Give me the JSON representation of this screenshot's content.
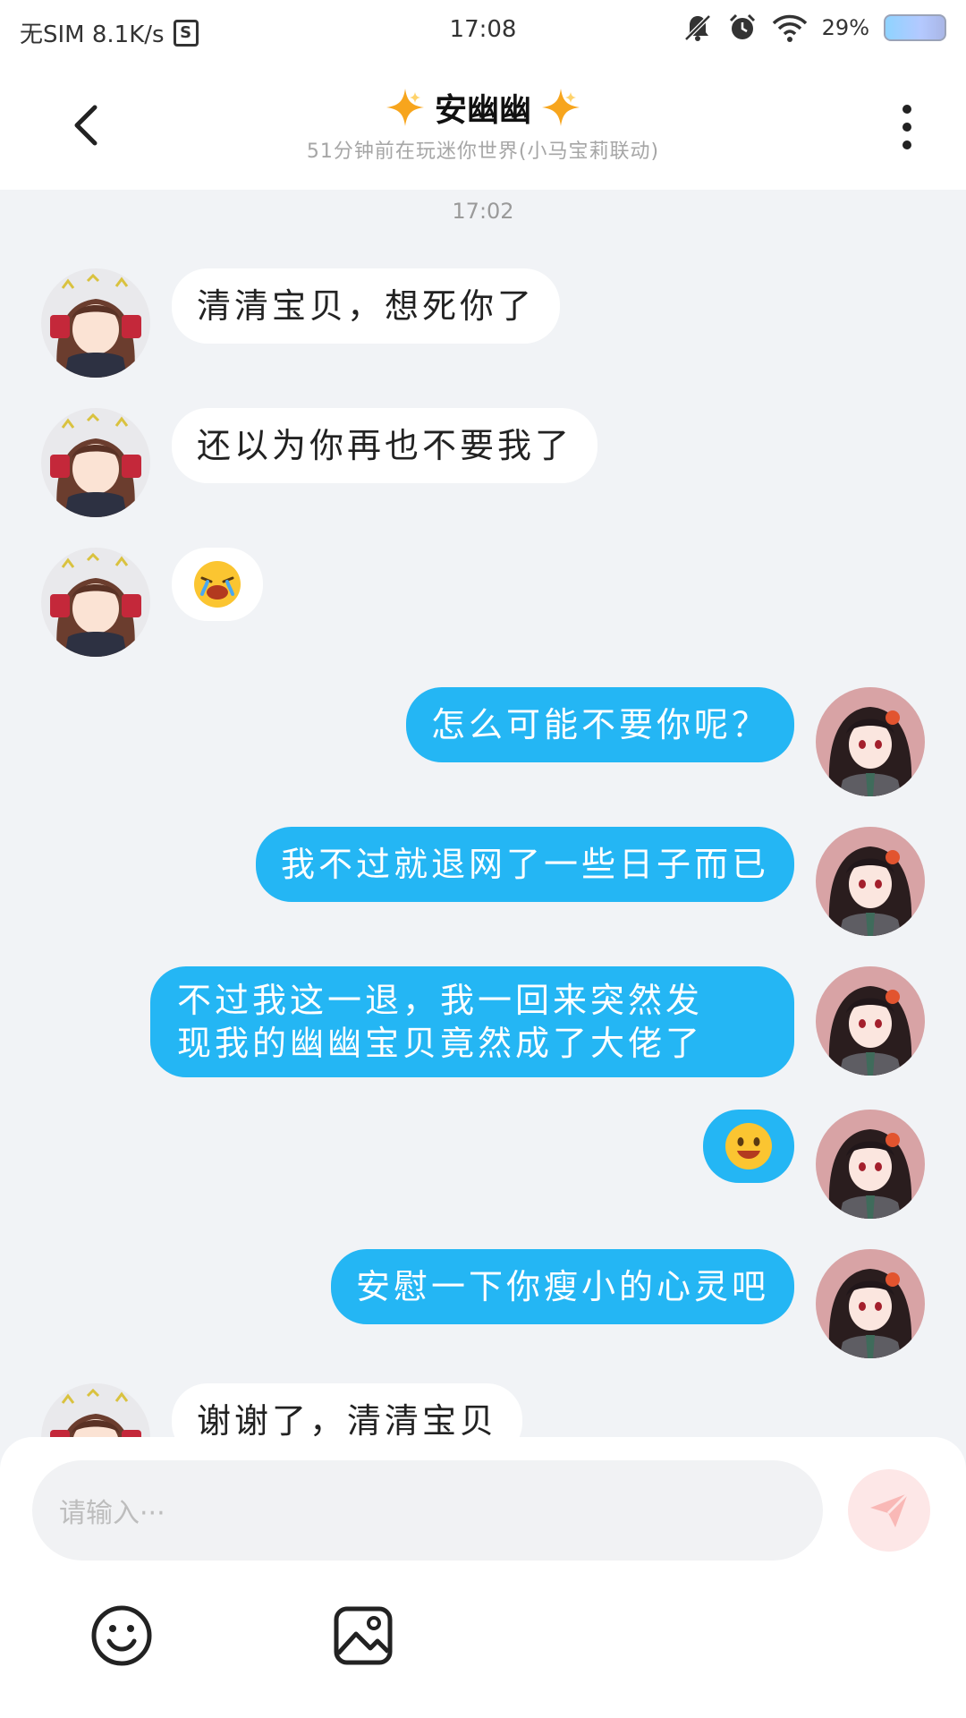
{
  "status_bar": {
    "left_text": "无SIM 8.1K/s",
    "s_icon_text": "S",
    "time": "17:08",
    "battery_text": "29%",
    "icons": [
      "mute-icon",
      "alarm-icon",
      "wifi-icon",
      "battery-icon"
    ]
  },
  "header": {
    "title": "安幽幽",
    "subtitle": "51分钟前在玩迷你世界(小马宝莉联动)",
    "accent_color": "#f7a51d"
  },
  "chat": {
    "timestamp": "17:02",
    "messages": [
      {
        "side": "in",
        "text": "清清宝贝，想死你了"
      },
      {
        "side": "in",
        "text": "还以为你再也不要我了"
      },
      {
        "side": "in",
        "type": "emoji",
        "emoji": "crying-face-emoji"
      },
      {
        "side": "out",
        "text": "怎么可能不要你呢？"
      },
      {
        "side": "out",
        "text": "我不过就退网了一些日子而已"
      },
      {
        "side": "out",
        "text_line1": "不过我这一退，我一回来突然发",
        "text_line2": "现我的幽幽宝贝竟然成了大佬了"
      },
      {
        "side": "out",
        "type": "emoji",
        "emoji": "smiling-face-emoji"
      },
      {
        "side": "out",
        "text": "安慰一下你瘦小的心灵吧"
      },
      {
        "side": "in",
        "text": "谢谢了，清清宝贝"
      }
    ],
    "outgoing_color": "#24b6f4",
    "incoming_color": "#ffffff"
  },
  "composer": {
    "placeholder": "请输入···",
    "tools": [
      "emoji-icon",
      "image-icon"
    ]
  }
}
